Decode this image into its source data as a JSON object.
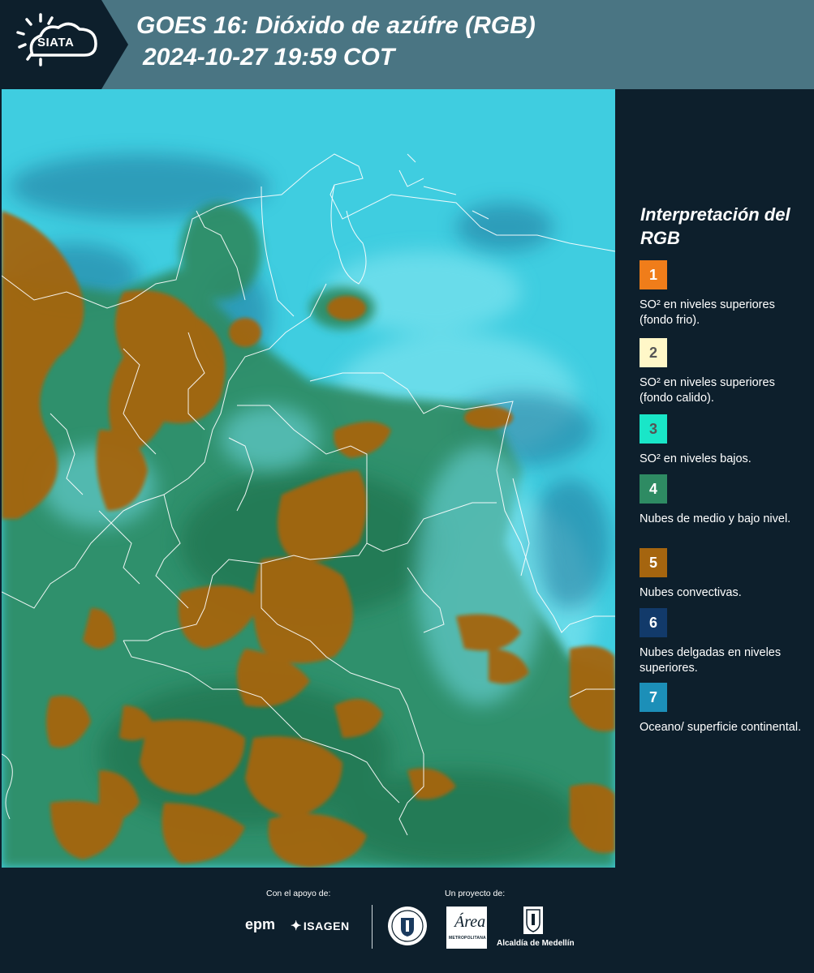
{
  "header": {
    "logo_text": "SIATA",
    "title": "GOES 16: Dióxido de azúfre (RGB)",
    "subtitle": "2024-10-27 19:59 COT"
  },
  "legend": {
    "title": "Interpretación del RGB",
    "items": [
      {
        "number": "1",
        "color": "#f07d1a",
        "number_color": "#ffffff",
        "description": "SO² en niveles superiores (fondo frio)."
      },
      {
        "number": "2",
        "color": "#fff7c8",
        "number_color": "#555555",
        "description": "SO² en niveles superiores (fondo calido)."
      },
      {
        "number": "3",
        "color": "#19e6c8",
        "number_color": "#555555",
        "description": "SO² en niveles bajos."
      },
      {
        "number": "4",
        "color": "#2e8b63",
        "number_color": "#ffffff",
        "description": "Nubes de medio y bajo nivel."
      },
      {
        "number": "5",
        "color": "#a5650f",
        "number_color": "#ffffff",
        "description": "Nubes convectivas."
      },
      {
        "number": "6",
        "color": "#123a6a",
        "number_color": "#ffffff",
        "description": "Nubes delgadas en niveles superiores."
      },
      {
        "number": "7",
        "color": "#1c8fb8",
        "number_color": "#ffffff",
        "description": "Oceano/ superficie continental."
      }
    ]
  },
  "footer": {
    "support_label": "Con el apoyo de:",
    "project_label": "Un proyecto de:",
    "epm": "epm",
    "isagen": "ISAGEN",
    "area_logo": "Área",
    "area_logo_small": "METROPOLITANA",
    "alcaldia": "Alcaldía de Medellín"
  },
  "colors": {
    "header_bg": "#4a7583",
    "page_bg": "#0d1f2c",
    "ocean_cyan": "#3fcde0",
    "cloud_brown": "#a5650f",
    "vegetation_green": "#2e8b63"
  }
}
